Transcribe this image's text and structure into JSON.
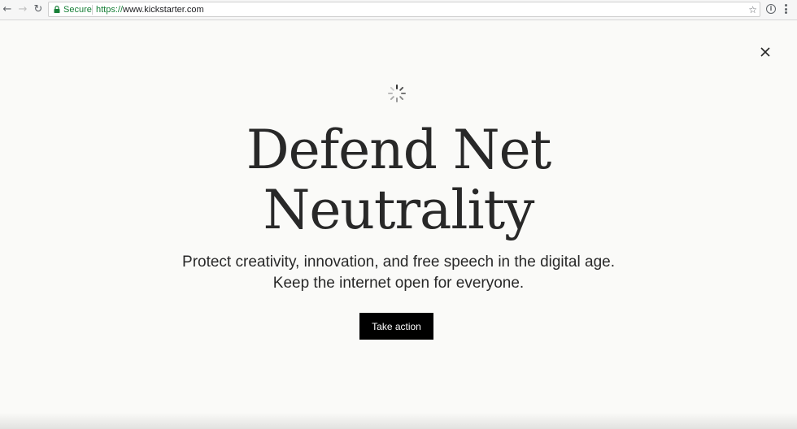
{
  "browser": {
    "secure_label": "Secure",
    "url_scheme": "https://",
    "url_host": "www.kickstarter.com",
    "icons": {
      "back": "back-arrow-icon",
      "forward": "forward-arrow-icon",
      "reload": "reload-icon",
      "lock": "lock-icon",
      "bookmark": "star-icon",
      "info": "info-icon",
      "menu": "kebab-menu-icon"
    },
    "secure_color": "#188038"
  },
  "modal": {
    "close_icon": "close-icon",
    "spinner_icon": "loading-spinner-icon",
    "headline_line1": "Defend Net",
    "headline_line2": "Neutrality",
    "body_text": "Protect creativity, innovation, and free speech in the digital age. Keep the internet open for everyone.",
    "cta_label": "Take action",
    "colors": {
      "background": "#fafaf8",
      "text": "#282828",
      "button_bg": "#000000",
      "button_text": "#ffffff"
    }
  }
}
